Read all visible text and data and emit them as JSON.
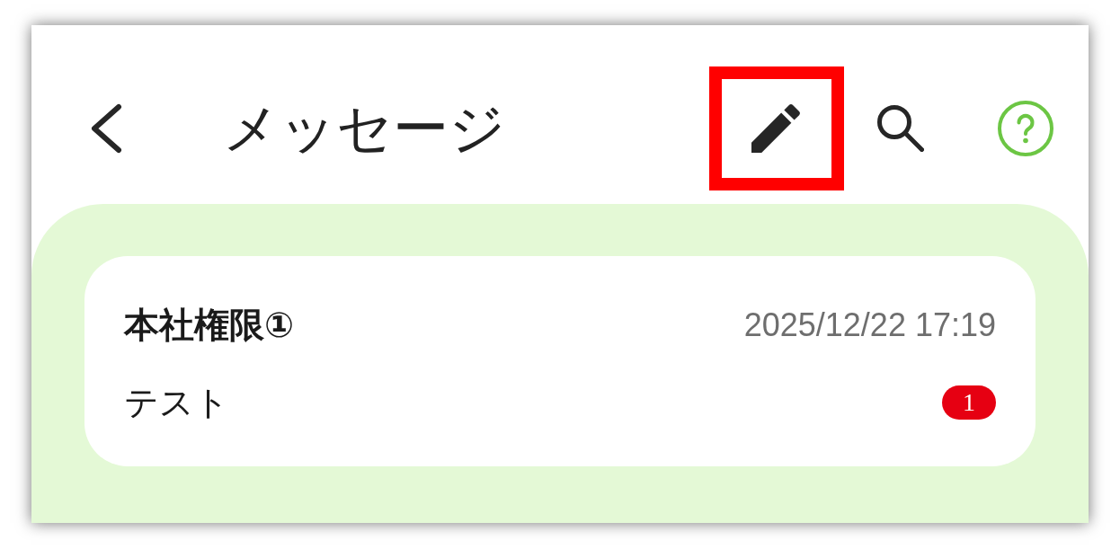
{
  "header": {
    "title": "メッセージ",
    "actions": [
      {
        "kind": "edit",
        "highlighted": true
      },
      {
        "kind": "search",
        "highlighted": false
      },
      {
        "kind": "help",
        "highlighted": false
      }
    ]
  },
  "conversations": [
    {
      "name": "本社権限①",
      "time": "2025/12/22 17:19",
      "preview": "テスト",
      "unread": "1"
    }
  ]
}
